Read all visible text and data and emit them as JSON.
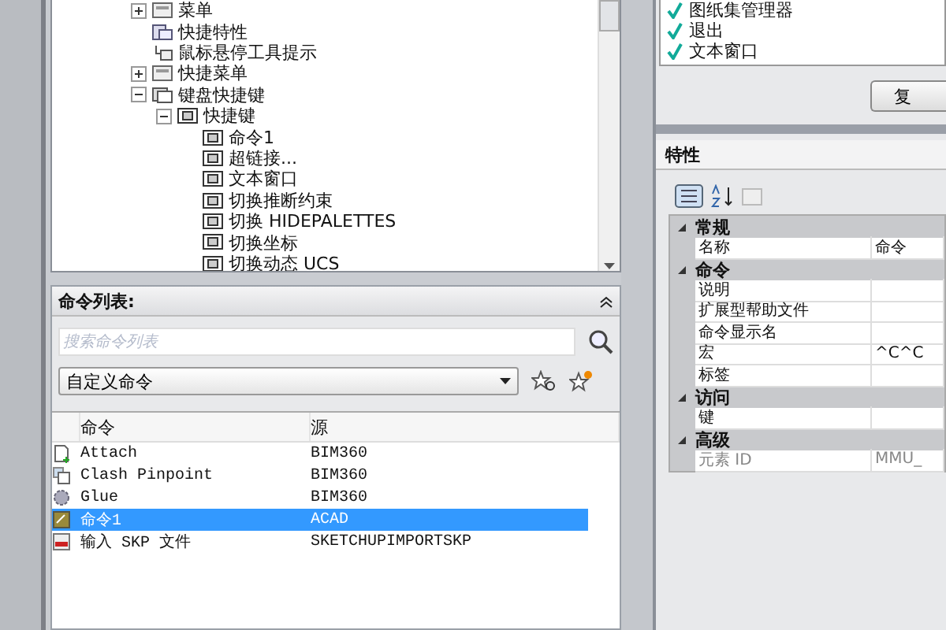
{
  "tree": {
    "items": [
      {
        "label": "菜单",
        "expanded": false,
        "kind": "menu"
      },
      {
        "label": "快捷特性",
        "kind": "props"
      },
      {
        "label": "鼠标悬停工具提示",
        "kind": "tooltip"
      },
      {
        "label": "快捷菜单",
        "expanded": false,
        "kind": "menu"
      },
      {
        "label": "键盘快捷键",
        "expanded": true,
        "kind": "keys",
        "children": [
          {
            "label": "快捷键",
            "expanded": true,
            "kind": "key",
            "children": [
              {
                "label": "命令1",
                "kind": "key"
              },
              {
                "label": "超链接...",
                "kind": "key"
              },
              {
                "label": "文本窗口",
                "kind": "key"
              },
              {
                "label": "切换推断约束",
                "kind": "key"
              },
              {
                "label": "切换 HIDEPALETTES",
                "kind": "key"
              },
              {
                "label": "切换坐标",
                "kind": "key"
              },
              {
                "label": "切换动态 UCS",
                "kind": "key"
              }
            ]
          }
        ]
      }
    ]
  },
  "command_list": {
    "title": "命令列表:",
    "search": {
      "placeholder": "搜索命令列表"
    },
    "filter": {
      "value": "自定义命令"
    },
    "columns": [
      "命令",
      "源"
    ],
    "rows": [
      {
        "name": "Attach",
        "source": "BIM360",
        "kind": "attach",
        "selected": false
      },
      {
        "name": "Clash Pinpoint",
        "source": "BIM360",
        "kind": "clash",
        "selected": false
      },
      {
        "name": "Glue",
        "source": "BIM360",
        "kind": "glue",
        "selected": false
      },
      {
        "name": "命令1",
        "source": "ACAD",
        "kind": "cmd",
        "selected": true
      },
      {
        "name": "输入 SKP 文件",
        "source": "SKETCHUPIMPORTSKP",
        "kind": "skp",
        "selected": false
      }
    ]
  },
  "checked_list": [
    {
      "label": "图纸集管理器",
      "checked": true
    },
    {
      "label": "退出",
      "checked": true
    },
    {
      "label": "文本窗口",
      "checked": true
    }
  ],
  "button": {
    "label": "复"
  },
  "properties": {
    "title": "特性",
    "sections": [
      {
        "title": "常规",
        "rows": [
          {
            "name": "名称",
            "value": "命令",
            "disabled": false
          }
        ]
      },
      {
        "title": "命令",
        "rows": [
          {
            "name": "说明",
            "disabled": false
          },
          {
            "name": "扩展型帮助文件",
            "disabled": false
          },
          {
            "name": "命令显示名",
            "disabled": false
          },
          {
            "name": "宏",
            "value": "^C^C",
            "disabled": false
          },
          {
            "name": "标签",
            "disabled": false
          }
        ]
      },
      {
        "title": "访问",
        "rows": [
          {
            "name": "键",
            "disabled": false
          }
        ]
      },
      {
        "title": "高级",
        "rows": [
          {
            "name": "元素 ID",
            "value": "MMU_",
            "disabled": true
          }
        ]
      }
    ]
  }
}
